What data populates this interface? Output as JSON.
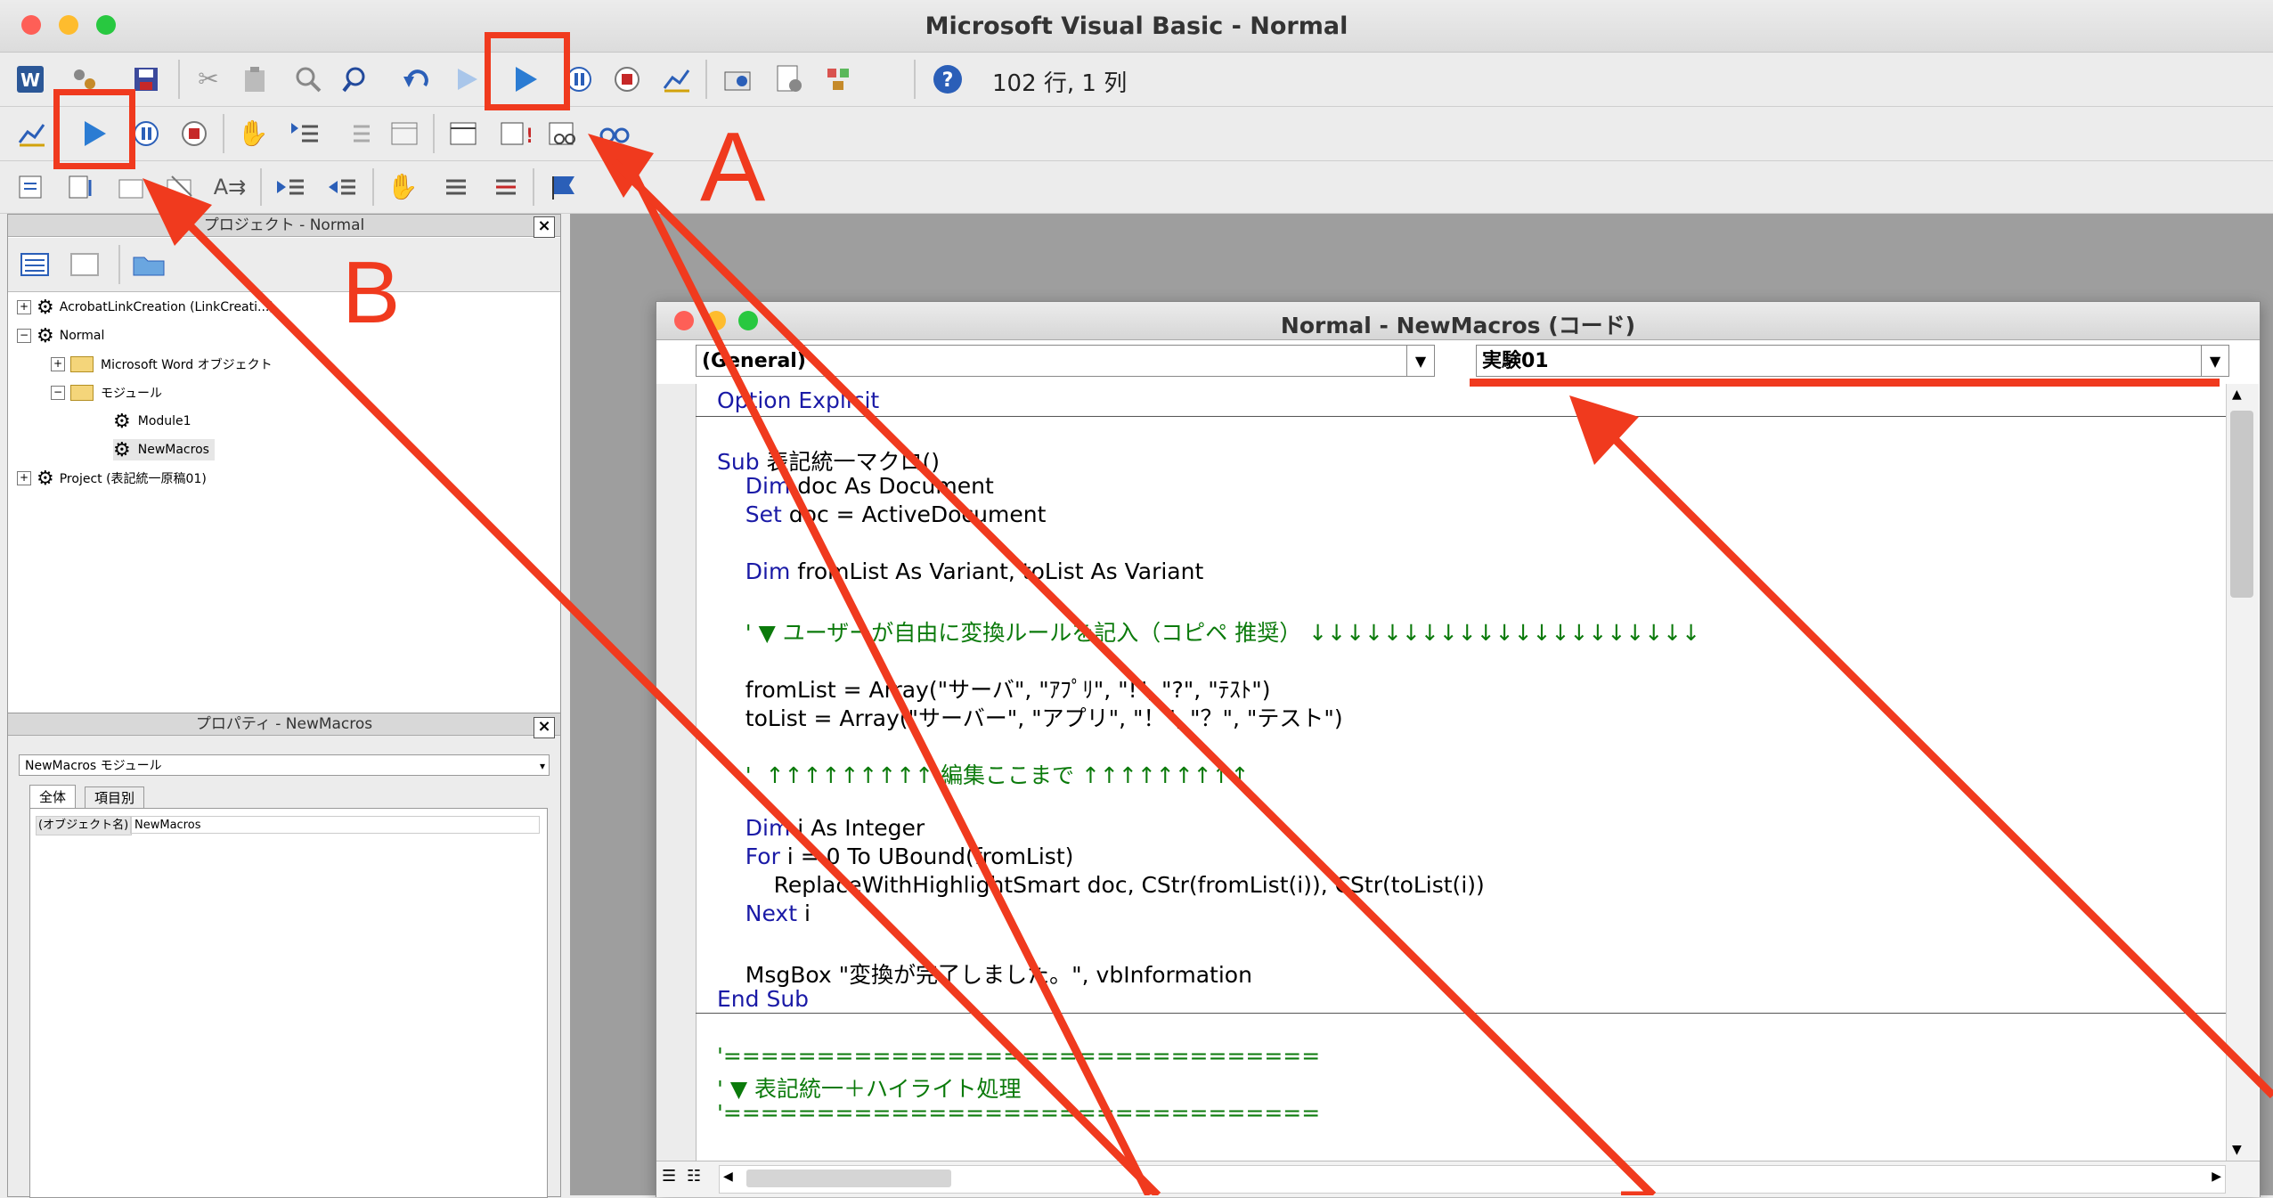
{
  "app": {
    "title": "Microsoft Visual Basic - Normal"
  },
  "toolbar": {
    "status": "102 行, 1 列"
  },
  "project_panel": {
    "title": "プロジェクト - Normal",
    "close_glyph": "×",
    "tree": [
      {
        "label": "AcrobatLinkCreation (LinkCreati...)"
      },
      {
        "label": "Normal"
      },
      {
        "label": "Microsoft Word オブジェクト"
      },
      {
        "label": "モジュール"
      },
      {
        "label": "Module1"
      },
      {
        "label": "NewMacros"
      },
      {
        "label": "Project (表記統一原稿01)"
      }
    ]
  },
  "properties_panel": {
    "title": "プロパティ - NewMacros",
    "close_glyph": "×",
    "object_select": "NewMacros  モジュール",
    "tabs": [
      {
        "label": "全体"
      },
      {
        "label": "項目別"
      }
    ],
    "row": {
      "name": "(オブジェクト名)",
      "value": "NewMacros"
    }
  },
  "code_window": {
    "title": "Normal - NewMacros (コード)",
    "object_dropdown": "(General)",
    "proc_dropdown": "実験01",
    "lines": [
      {
        "kw": "Option Explicit",
        "text": ""
      },
      {
        "kw": "",
        "text": ""
      },
      {
        "kw": "Sub ",
        "text": "表記統一マクロ()"
      },
      {
        "kw": "    Dim ",
        "text": "doc As Document"
      },
      {
        "kw": "    Set ",
        "text": "doc = ActiveDocument"
      },
      {
        "kw": "",
        "text": ""
      },
      {
        "kw": "    Dim ",
        "text": "fromList As Variant, toList As Variant"
      },
      {
        "kw": "",
        "text": ""
      },
      {
        "cm": "    ' ▼ ユーザーが自由に変換ルールを記入（コピペ 推奨） ↓↓↓↓↓↓↓↓↓↓↓↓↓↓↓↓↓↓↓↓↓"
      },
      {
        "kw": "",
        "text": ""
      },
      {
        "kw": "",
        "text": "    fromList = Array(\"サーバ\", \"ｱﾌﾟﾘ\", \"!\", \"?\", \"ﾃｽﾄ\")"
      },
      {
        "kw": "",
        "text": "    toList = Array(\"サーバー\", \"アプリ\", \"！\", \"？\", \"テスト\")"
      },
      {
        "kw": "",
        "text": ""
      },
      {
        "cm": "    '  ↑↑↑↑↑↑↑↑↑ 編集ここまで ↑↑↑↑↑↑↑↑↑"
      },
      {
        "kw": "",
        "text": ""
      },
      {
        "kw": "    Dim ",
        "text": "i As Integer"
      },
      {
        "kw": "    For ",
        "text": "i = 0 To UBound(fromList)"
      },
      {
        "kw": "",
        "text": "        ReplaceWithHighlightSmart doc, CStr(fromList(i)), CStr(toList(i))"
      },
      {
        "kw": "    Next ",
        "text": "i"
      },
      {
        "kw": "",
        "text": ""
      },
      {
        "kw": "",
        "text": "    MsgBox \"変換が完了しました。\", vbInformation"
      },
      {
        "kw": "End Sub",
        "text": ""
      },
      {
        "kw": "",
        "text": ""
      },
      {
        "cm": "'================================"
      },
      {
        "cm": "' ▼ 表記統一＋ハイライト処理"
      },
      {
        "cm": "'================================"
      }
    ]
  },
  "annotations": {
    "label_a": "A",
    "label_b": "B",
    "color": "#f03a1e"
  },
  "colors": {
    "accent_red": "#f03a1e",
    "keyword": "#1a1aa6",
    "comment": "#0b7a0b",
    "run": "#2b7cd3"
  }
}
